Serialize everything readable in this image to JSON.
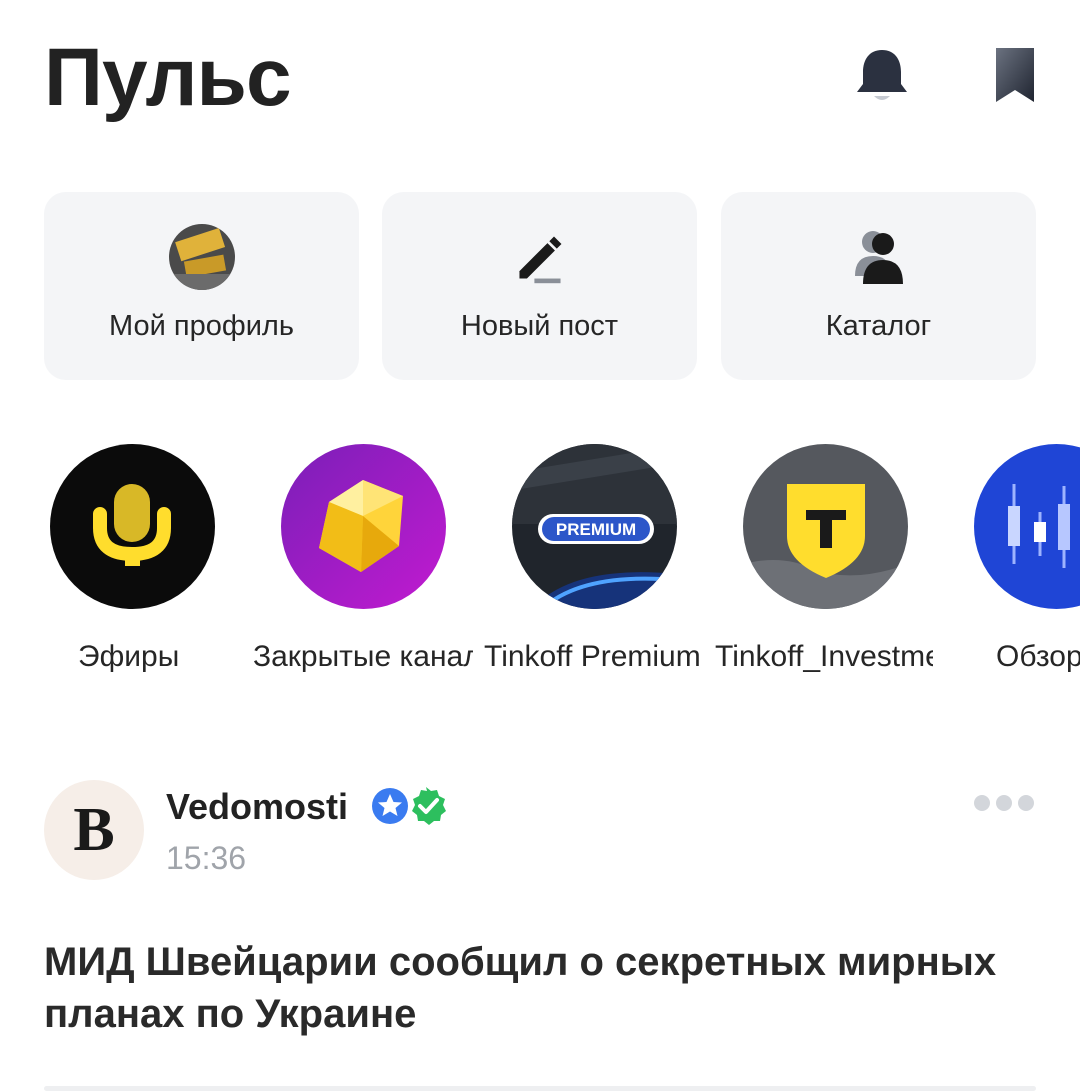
{
  "header": {
    "title": "Пульс",
    "icons": {
      "notifications": "bell-icon",
      "bookmarks": "bookmark-icon"
    }
  },
  "quick_actions": [
    {
      "label": "Мой профиль",
      "icon": "profile-avatar"
    },
    {
      "label": "Новый пост",
      "icon": "pencil-icon"
    },
    {
      "label": "Каталог",
      "icon": "catalog-people-icon"
    }
  ],
  "stories": [
    {
      "label": "Эфиры",
      "icon": "microphone-icon"
    },
    {
      "label": "Закрытые каналы",
      "icon": "gem-icon"
    },
    {
      "label": "Tinkoff Premium",
      "icon": "premium-badge",
      "badge_text": "PREMIUM"
    },
    {
      "label": "Tinkoff_Investments",
      "icon": "tinkoff-shield-icon",
      "badge_text": "T"
    },
    {
      "label": "Обзоры",
      "icon": "candlestick-chart-icon"
    }
  ],
  "post": {
    "avatar_letter": "B",
    "author": "Vedomosti",
    "time": "15:36",
    "title": "МИД Швейцарии сообщил о секретных мирных планах по Украине",
    "badges": [
      "star-badge-icon",
      "verified-check-icon"
    ]
  },
  "colors": {
    "accent_yellow": "#ffdd2d",
    "text_primary": "#222222",
    "text_secondary": "#a0a4aa",
    "card_bg": "#f4f5f7",
    "verified_green": "#2dbf5e",
    "star_blue": "#3a7bf0"
  }
}
